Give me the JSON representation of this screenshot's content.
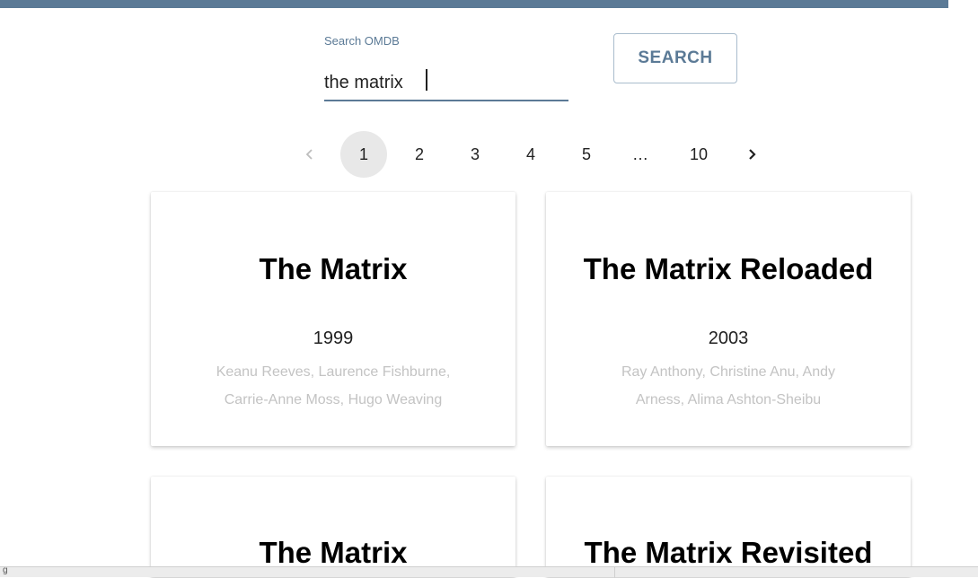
{
  "search": {
    "label": "Search OMDB",
    "value": "the matrix",
    "button_label": "SEARCH"
  },
  "pagination": {
    "prev_icon": "chevron-left-icon",
    "next_icon": "chevron-right-icon",
    "pages": [
      "1",
      "2",
      "3",
      "4",
      "5",
      "…",
      "10"
    ],
    "current": "1"
  },
  "results": [
    {
      "title": "The Matrix",
      "year": "1999",
      "cast_line1": "Keanu Reeves, Laurence Fishburne,",
      "cast_line2": "Carrie-Anne Moss, Hugo Weaving"
    },
    {
      "title": "The Matrix Reloaded",
      "year": "2003",
      "cast_line1": "Ray Anthony, Christine Anu, Andy",
      "cast_line2": "Arness, Alima Ashton-Sheibu"
    },
    {
      "title": "The Matrix"
    },
    {
      "title": "The Matrix Revisited"
    }
  ],
  "status_bar": {
    "glyph": "g"
  },
  "colors": {
    "accent": "#5b7a96",
    "muted_text": "#c3c3c3",
    "current_page_bg": "#e8e8e8"
  }
}
